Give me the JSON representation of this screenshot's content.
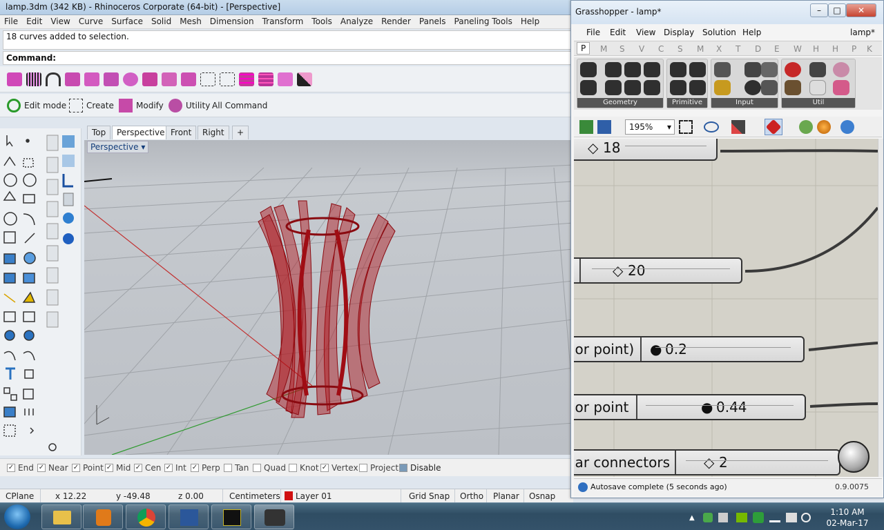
{
  "rhino": {
    "title": "lamp.3dm (342 KB) - Rhinoceros Corporate (64-bit) - [Perspective]",
    "menu": [
      "File",
      "Edit",
      "View",
      "Curve",
      "Surface",
      "Solid",
      "Mesh",
      "Dimension",
      "Transform",
      "Tools",
      "Analyze",
      "Render",
      "Panels",
      "Paneling Tools",
      "Help"
    ],
    "history": "18 curves added to selection.",
    "command_label": "Command:",
    "toolbar2": {
      "edit_mode": "Edit mode",
      "create": "Create",
      "modify": "Modify",
      "utility": "Utility",
      "all_command": "All Command"
    },
    "view_tabs": [
      "Top",
      "Perspective",
      "Front",
      "Right"
    ],
    "add_tab": "+",
    "viewport_label": "Perspective",
    "osnaps": [
      {
        "label": "End",
        "checked": true
      },
      {
        "label": "Near",
        "checked": true
      },
      {
        "label": "Point",
        "checked": true
      },
      {
        "label": "Mid",
        "checked": true
      },
      {
        "label": "Cen",
        "checked": true
      },
      {
        "label": "Int",
        "checked": true
      },
      {
        "label": "Perp",
        "checked": true
      },
      {
        "label": "Tan",
        "checked": false
      },
      {
        "label": "Quad",
        "checked": false
      },
      {
        "label": "Knot",
        "checked": false
      },
      {
        "label": "Vertex",
        "checked": true
      },
      {
        "label": "Project",
        "checked": false
      },
      {
        "label": "Disable",
        "checked": false
      }
    ],
    "status": {
      "cplane": "CPlane",
      "x": "x 12.22",
      "y": "y -49.48",
      "z": "z 0.00",
      "units": "Centimeters",
      "layer": "Layer 01",
      "layer_color": "#d01010",
      "grid_snap": "Grid Snap",
      "ortho": "Ortho",
      "planar": "Planar",
      "osnap": "Osnap"
    }
  },
  "gh": {
    "title": "Grasshopper - lamp*",
    "doc_name": "lamp*",
    "menu": [
      "File",
      "Edit",
      "View",
      "Display",
      "Solution",
      "Help"
    ],
    "tabs": [
      "P",
      "M",
      "S",
      "V",
      "C",
      "S",
      "M",
      "X",
      "T",
      "D",
      "E",
      "W",
      "H",
      "H",
      "P",
      "K"
    ],
    "groups": [
      "Geometry",
      "Primitive",
      "Input",
      "Util"
    ],
    "zoom": "195%",
    "sliders": [
      {
        "label": "",
        "value": "18",
        "marker": "diamond"
      },
      {
        "label": "",
        "value": "20",
        "marker": "diamond"
      },
      {
        "label": "ior point)",
        "value": "0.2",
        "marker": "circle"
      },
      {
        "label": "ior point",
        "value": "0.44",
        "marker": "circle"
      },
      {
        "label": "lar connectors",
        "value": "2",
        "marker": "diamond"
      }
    ],
    "footer_status": "Autosave complete (5 seconds ago)",
    "version": "0.9.0075"
  },
  "taskbar": {
    "time": "1:10 AM",
    "date": "02-Mar-17"
  },
  "colors": {
    "lamp_red": "#b01218",
    "rhino_title": "#c9dced",
    "gh_canvas": "#d4d2c9"
  }
}
